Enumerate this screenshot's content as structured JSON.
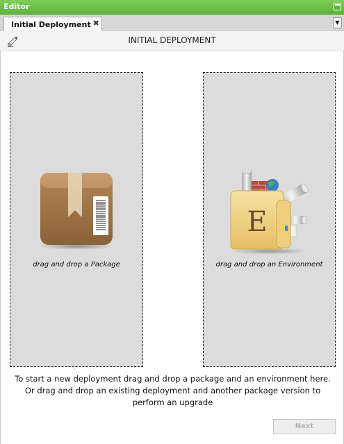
{
  "window": {
    "title": "Editor"
  },
  "tabs": [
    {
      "label": "Initial Deployment",
      "close": "✖"
    }
  ],
  "tab_dropdown_glyph": "▼",
  "header": {
    "title": "INITIAL DEPLOYMENT",
    "icon": "pencil-icon"
  },
  "dropzones": {
    "package": {
      "label": "drag and drop a Package",
      "icon": "package-box-icon"
    },
    "environment": {
      "label": "drag and drop an Environment",
      "icon": "environment-folder-icon",
      "letter": "E"
    }
  },
  "instructions": "To start a new deployment drag and drop a package and an environment here. Or drag and drop an existing deployment and another package version to perform an upgrade",
  "buttons": {
    "next": "Next"
  },
  "colors": {
    "titlebar": "#6cc048",
    "dropzone": "#dcdcdc",
    "box": "#a87d4f",
    "folder": "#f0d38a"
  }
}
